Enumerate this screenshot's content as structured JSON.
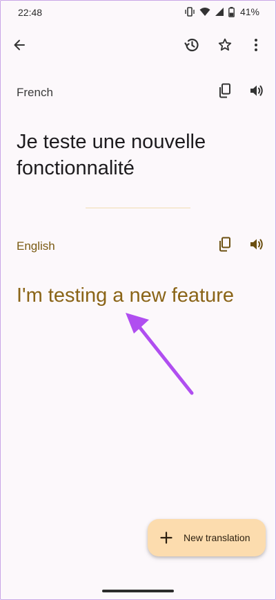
{
  "status_bar": {
    "time": "22:48",
    "battery_percent": "41%",
    "icons": [
      "vibrate-icon",
      "wifi-icon",
      "signal-icon",
      "battery-icon"
    ]
  },
  "app_bar": {
    "icons": [
      "back-arrow-icon",
      "history-icon",
      "star-icon",
      "more-vert-icon"
    ]
  },
  "source": {
    "language": "French",
    "text": "Je teste une nouvelle fonctionnalité"
  },
  "target": {
    "language": "English",
    "text": "I'm testing a new feature"
  },
  "fab": {
    "label": "New translation"
  },
  "colors": {
    "background": "#fcf8fb",
    "accent_text": "#8a6417",
    "fab_background": "#fcdcae",
    "annotation_arrow": "#b04ef0"
  }
}
